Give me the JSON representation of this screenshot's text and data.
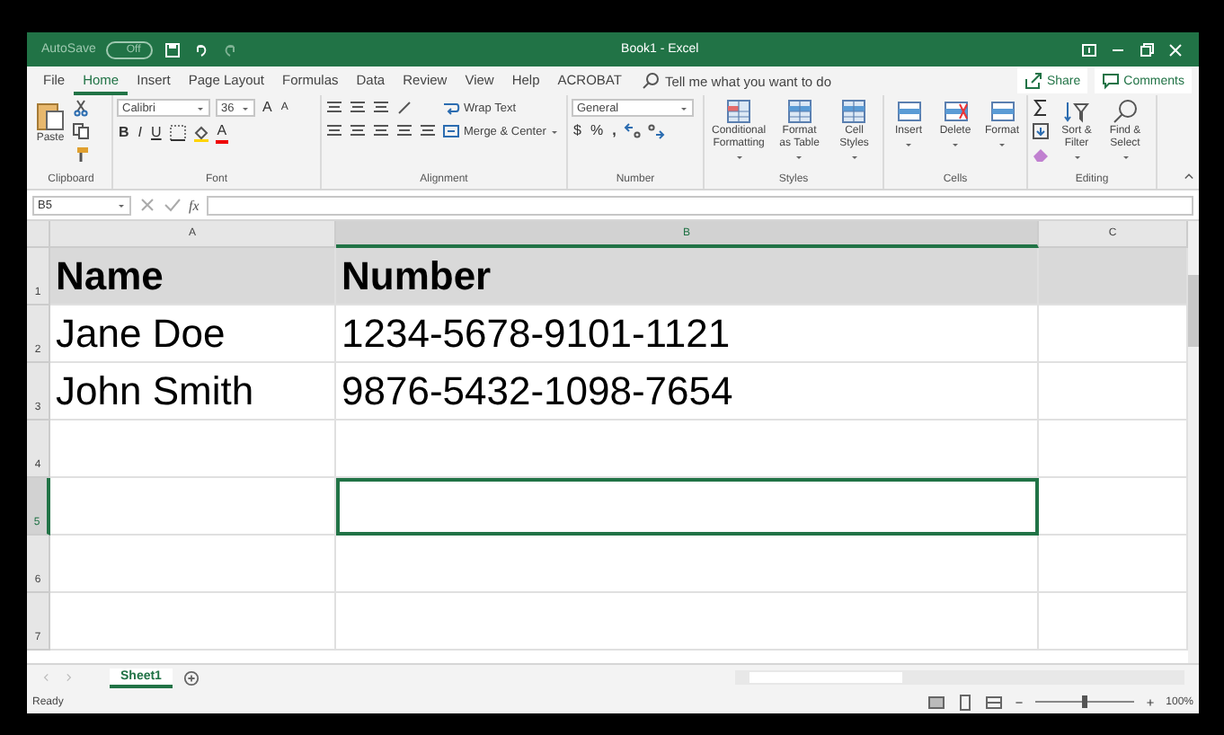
{
  "window": {
    "autosave_label": "AutoSave",
    "autosave_state": "Off",
    "title": "Book1 - Excel"
  },
  "ribbon_tabs": [
    {
      "label": "File",
      "selected": false
    },
    {
      "label": "Home",
      "selected": true
    },
    {
      "label": "Insert",
      "selected": false
    },
    {
      "label": "Page Layout",
      "selected": false
    },
    {
      "label": "Formulas",
      "selected": false
    },
    {
      "label": "Data",
      "selected": false
    },
    {
      "label": "Review",
      "selected": false
    },
    {
      "label": "View",
      "selected": false
    },
    {
      "label": "Help",
      "selected": false
    },
    {
      "label": "ACROBAT",
      "selected": false
    }
  ],
  "tell_me": {
    "placeholder": "Tell me what you want to do"
  },
  "share_button": "Share",
  "comments_button": "Comments",
  "ribbon": {
    "clipboard": {
      "paste": "Paste",
      "label": "Clipboard"
    },
    "font": {
      "font_name": "Calibri",
      "font_size": "36",
      "grow": "A",
      "shrink": "A",
      "bold": "B",
      "italic": "I",
      "underline": "U",
      "font_color": "A",
      "label": "Font"
    },
    "alignment": {
      "wrap_text": "Wrap Text",
      "merge": "Merge & Center",
      "label": "Alignment"
    },
    "number": {
      "format": "General",
      "currency": "$",
      "percent": "%",
      "comma": ",",
      "label": "Number"
    },
    "styles": {
      "commands": [
        "Conditional Formatting",
        "Format as Table",
        "Cell Styles"
      ],
      "label": "Styles"
    },
    "cells": {
      "commands": [
        "Insert",
        "Delete",
        "Format"
      ],
      "label": "Cells"
    },
    "editing": {
      "commands": [
        "Sort & Filter",
        "Find & Select"
      ],
      "label": "Editing"
    }
  },
  "formula_bar": {
    "name_box": "B5",
    "function_label": "fx"
  },
  "sheet": {
    "columns": [
      {
        "name": "A",
        "selected": false
      },
      {
        "name": "B",
        "selected": true
      },
      {
        "name": "C",
        "selected": false
      }
    ],
    "rows": [
      {
        "number": "1",
        "kind": "header",
        "selected": false,
        "cells": [
          "Name",
          "Number"
        ]
      },
      {
        "number": "2",
        "kind": "data",
        "selected": false,
        "cells": [
          "Jane Doe",
          "1234-5678-9101-1121"
        ]
      },
      {
        "number": "3",
        "kind": "data",
        "selected": false,
        "cells": [
          "John Smith",
          "9876-5432-1098-7654"
        ]
      },
      {
        "number": "4",
        "kind": "data",
        "selected": false
      },
      {
        "number": "5",
        "kind": "data",
        "selected": true
      },
      {
        "number": "6",
        "kind": "data",
        "selected": false
      },
      {
        "number": "7",
        "kind": "data",
        "selected": false
      }
    ]
  },
  "sheet_tabs": [
    {
      "label": "Sheet1",
      "selected": true
    }
  ],
  "status_bar": {
    "status": "Ready",
    "zoom_slider": {
      "level": 0.5
    },
    "zoom": "100%"
  }
}
